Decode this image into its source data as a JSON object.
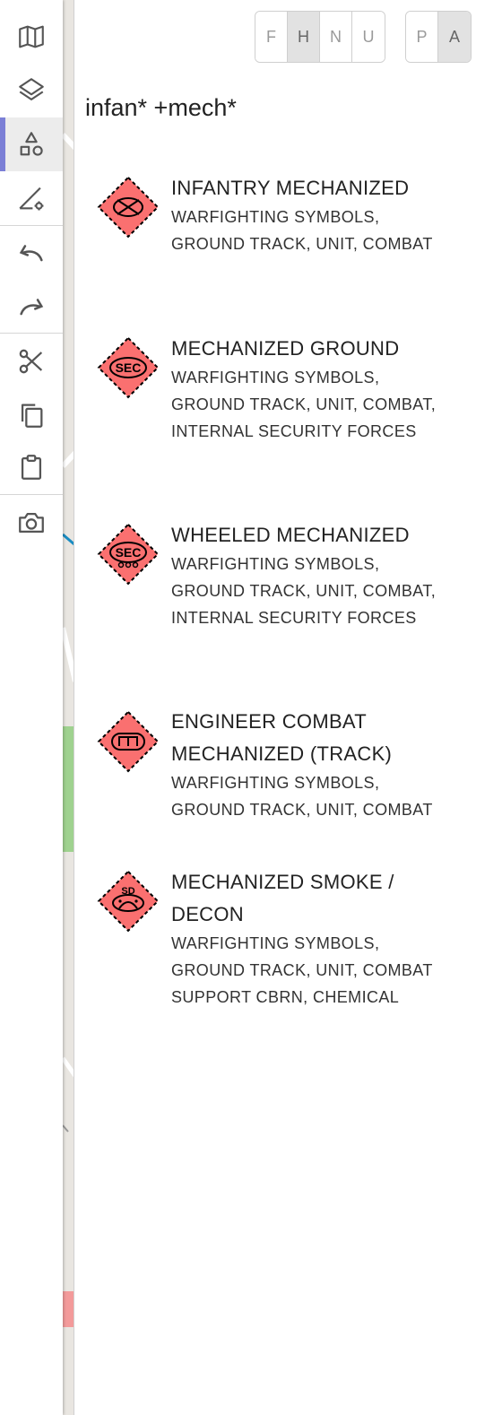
{
  "toolbar": {
    "items": [
      {
        "icon": "map-icon"
      },
      {
        "icon": "layers-icon"
      },
      {
        "icon": "shapes-icon",
        "active": true
      },
      {
        "icon": "draw-properties-icon"
      },
      {
        "icon": "undo-icon"
      },
      {
        "icon": "redo-icon"
      },
      {
        "icon": "cut-icon"
      },
      {
        "icon": "copy-icon"
      },
      {
        "icon": "paste-icon"
      },
      {
        "icon": "camera-icon"
      }
    ],
    "accent_color": "#7b7fd6"
  },
  "affiliation": {
    "options": [
      "F",
      "H",
      "N",
      "U"
    ],
    "selected": "H"
  },
  "status": {
    "options": [
      "P",
      "A"
    ],
    "selected": "A"
  },
  "search": {
    "value": "infan* +mech*"
  },
  "symbol_fill": "#fa7070",
  "results": [
    {
      "title_lines": [
        "INFANTRY MECHANIZED"
      ],
      "meta_lines": [
        "WARFIGHTING SYMBOLS,",
        "GROUND TRACK, UNIT, COMBAT"
      ],
      "icon": "infantry-mechanized-icon"
    },
    {
      "title_lines": [
        "MECHANIZED GROUND"
      ],
      "meta_lines": [
        "WARFIGHTING SYMBOLS,",
        "GROUND TRACK, UNIT, COMBAT,",
        "INTERNAL SECURITY FORCES"
      ],
      "icon": "security-mechanized-ground-icon",
      "symbol_text": "SEC"
    },
    {
      "title_lines": [
        "WHEELED MECHANIZED"
      ],
      "meta_lines": [
        "WARFIGHTING SYMBOLS,",
        "GROUND TRACK, UNIT, COMBAT,",
        "INTERNAL SECURITY FORCES"
      ],
      "icon": "security-wheeled-mechanized-icon",
      "symbol_text": "SEC"
    },
    {
      "title_lines": [
        "ENGINEER COMBAT",
        "MECHANIZED (TRACK)"
      ],
      "meta_lines": [
        "WARFIGHTING SYMBOLS,",
        "GROUND TRACK, UNIT, COMBAT"
      ],
      "icon": "engineer-combat-mechanized-icon"
    },
    {
      "title_lines": [
        "MECHANIZED SMOKE /",
        "DECON"
      ],
      "meta_lines": [
        "WARFIGHTING SYMBOLS,",
        "GROUND TRACK, UNIT, COMBAT",
        "SUPPORT CBRN, CHEMICAL"
      ],
      "icon": "smoke-decon-mechanized-icon",
      "symbol_text": "SD"
    }
  ],
  "map": {
    "road_color": "#ffffff",
    "green_area_color": "#9fd28f",
    "water_line_color": "#1a8cc2",
    "label_color": "#f39a9a"
  }
}
